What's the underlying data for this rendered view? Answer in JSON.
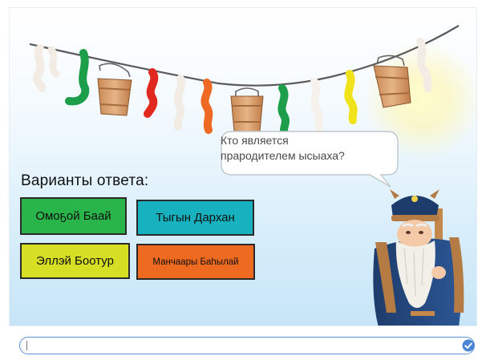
{
  "question": {
    "line1": "Кто является",
    "line2": "прародителем ысыаха?"
  },
  "answers_title": "Варианты ответа:",
  "answers": [
    {
      "label": "Омоҕой Баай",
      "color": "#2ab54b"
    },
    {
      "label": "Тыгын Дархан",
      "color": "#18b1bf"
    },
    {
      "label": "Эллэй Боотур",
      "color": "#d6df24"
    },
    {
      "label": "Манчаары Баһылай",
      "color": "#ef6a21"
    }
  ],
  "answer_input": {
    "value": ""
  },
  "icons": {
    "submit": "check-circle-icon"
  }
}
